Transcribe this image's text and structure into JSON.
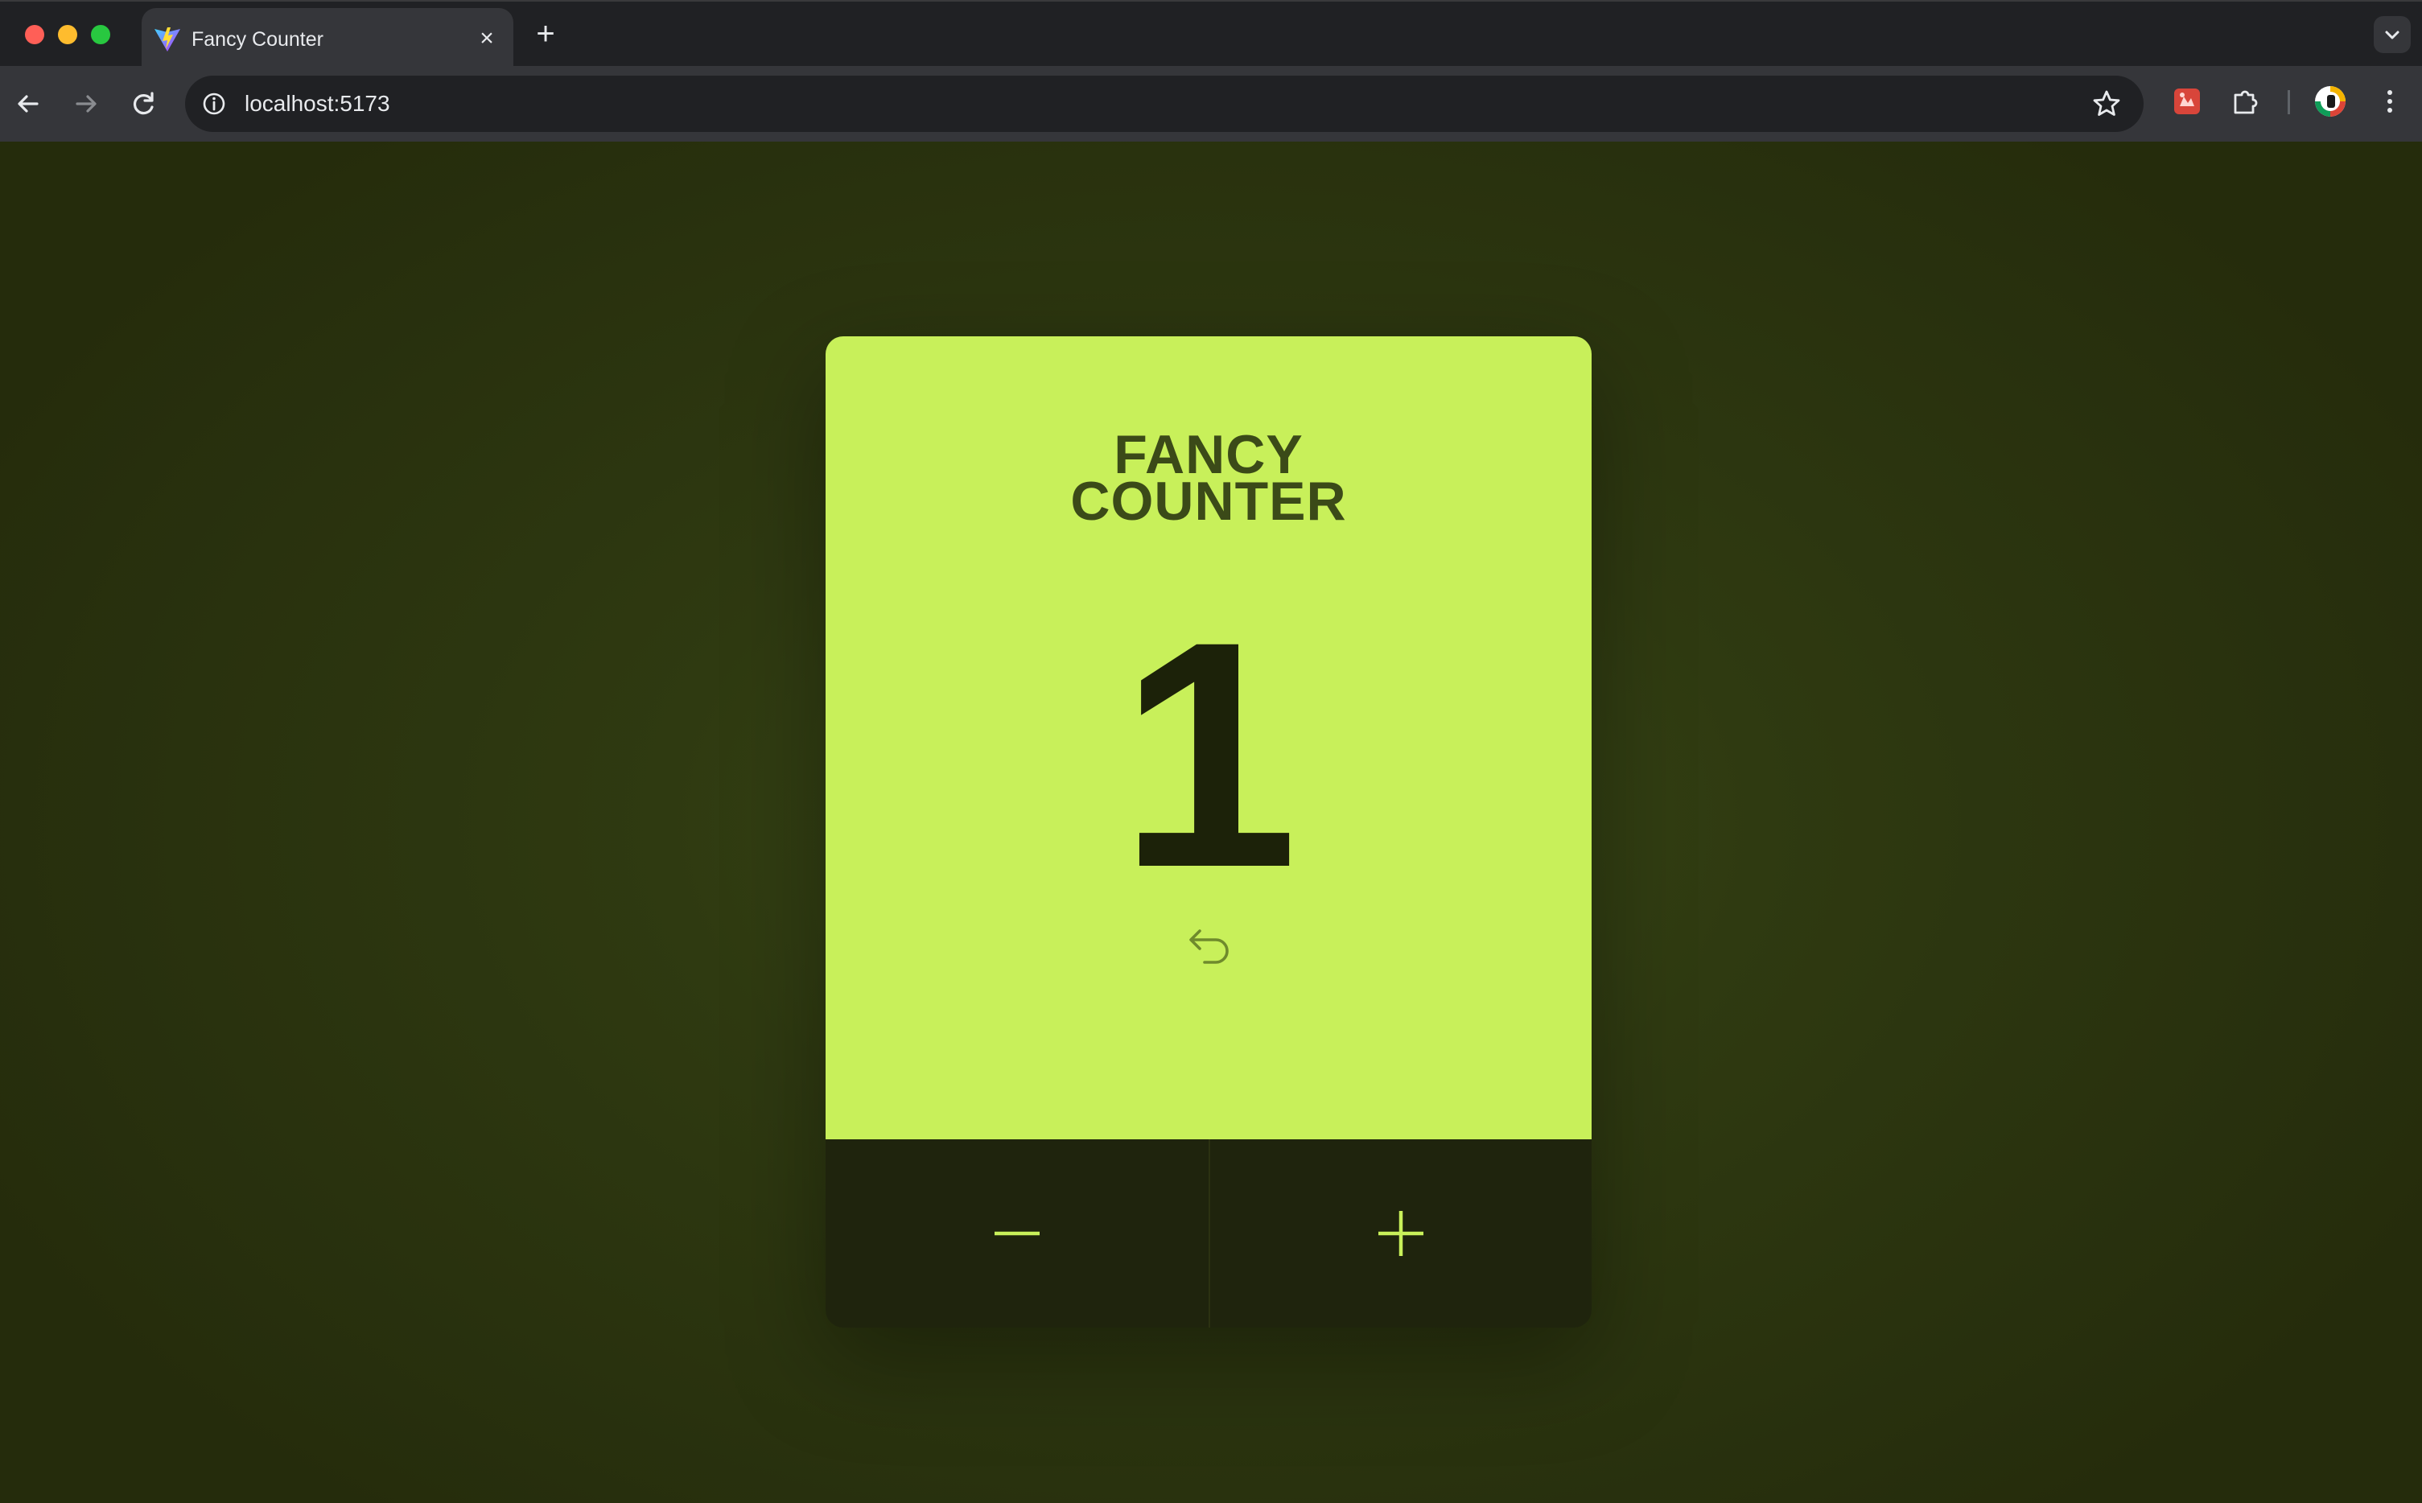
{
  "browser": {
    "tab_title": "Fancy Counter",
    "url": "localhost:5173",
    "icons": [
      "back-icon",
      "forward-icon",
      "reload-icon",
      "info-icon",
      "star-icon",
      "extension-red-icon",
      "puzzle-icon",
      "avatar",
      "menu-kebab-icon"
    ]
  },
  "app": {
    "title_line1": "FANCY",
    "title_line2": "COUNTER",
    "count": "1",
    "reset_icon": "undo-icon",
    "decrement_icon": "minus-icon",
    "increment_icon": "plus-icon"
  },
  "colors": {
    "accent": "#c8f05a",
    "dark": "#1f240d",
    "background": "#2f3a11"
  }
}
